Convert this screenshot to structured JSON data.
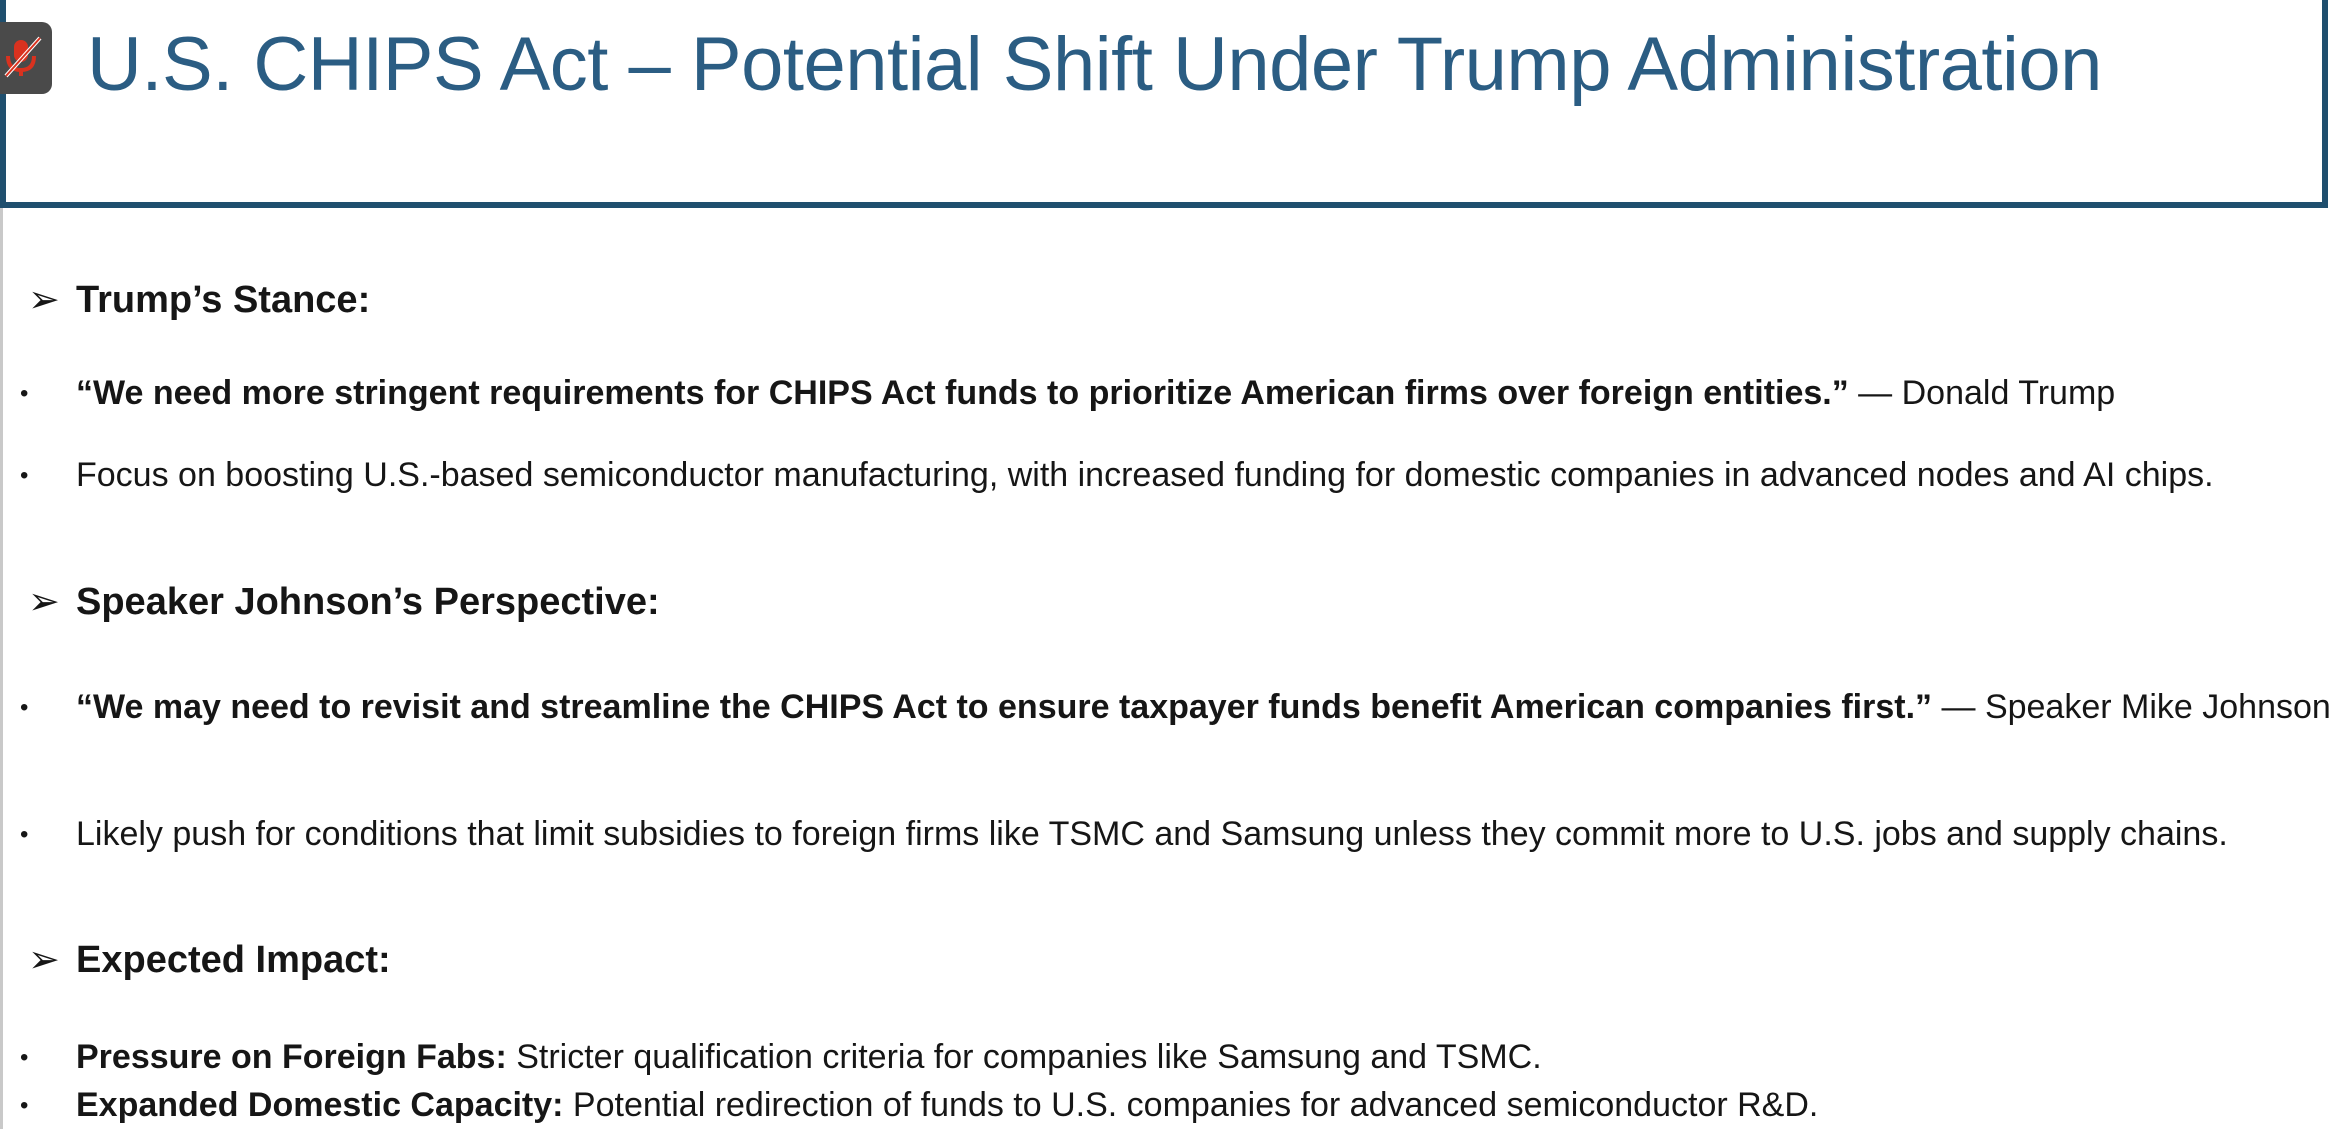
{
  "slide": {
    "title": "U.S. CHIPS Act – Potential Shift Under Trump Administration"
  },
  "sections": [
    {
      "heading": "Trump’s Stance:",
      "bullets": [
        {
          "bold": "“We need more stringent requirements for CHIPS Act funds to prioritize American firms over foreign entities.”",
          "rest": " — Donald Trump"
        },
        {
          "bold": "",
          "rest": "Focus on boosting U.S.-based semiconductor manufacturing, with increased funding for domestic companies in advanced nodes and AI chips."
        }
      ]
    },
    {
      "heading": "Speaker Johnson’s Perspective:",
      "bullets": [
        {
          "bold": "“We may need to revisit and streamline the CHIPS Act to ensure taxpayer funds benefit American companies first.”",
          "rest": " — Speaker Mike Johnson"
        },
        {
          "bold": "",
          "rest": "Likely push for conditions that limit subsidies to foreign firms like TSMC and Samsung unless they commit more to U.S. jobs and supply chains."
        }
      ]
    },
    {
      "heading": "Expected Impact:",
      "bullets": [
        {
          "bold": "Pressure on Foreign Fabs:",
          "rest": " Stricter qualification criteria for companies like Samsung and TSMC."
        },
        {
          "bold": "Expanded Domestic Capacity:",
          "rest": " Potential redirection of funds to U.S. companies for advanced semiconductor R&D."
        }
      ]
    }
  ],
  "symbols": {
    "arrow": "➢",
    "dot": "•"
  },
  "icons": {
    "mic_status": "mic-muted-icon"
  },
  "colors": {
    "title": "#2b5d83",
    "frame": "#1f4f6e",
    "mic_icon": "#d9321f"
  }
}
